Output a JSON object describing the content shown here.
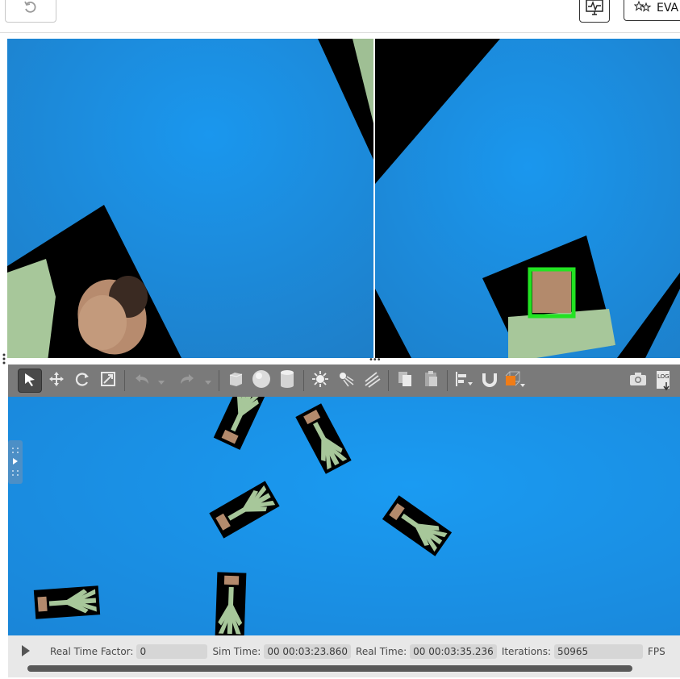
{
  "topbar": {
    "undo_icon": "undo-icon",
    "monitor_icon": "activity-monitor-icon",
    "eval_label": "EVA",
    "eval_icon": "stars-icon"
  },
  "colors": {
    "sky_blue": "#1a93e8",
    "cloth": "#a7c79a",
    "detection_box": "#22e322",
    "toolbar_bg": "#7a7a7a"
  },
  "gazebo": {
    "toolbar_icons": [
      "select-arrow-icon",
      "translate-icon",
      "rotate-icon",
      "scale-icon",
      "undo-icon",
      "redo-icon",
      "box-shape-icon",
      "sphere-shape-icon",
      "cylinder-shape-icon",
      "point-light-icon",
      "spot-light-icon",
      "directional-light-icon",
      "copy-icon",
      "paste-icon",
      "align-icon",
      "snap-icon",
      "view-angle-icon",
      "screenshot-icon",
      "log-icon"
    ],
    "log_label": "LOG",
    "status": {
      "rtf_label": "Real Time Factor:",
      "rtf_value": "0",
      "sim_label": "Sim Time:",
      "sim_value": "00 00:03:23.860",
      "real_label": "Real Time:",
      "real_value": "00 00:03:35.236",
      "iter_label": "Iterations:",
      "iter_value": "50965",
      "fps_label": "FPS"
    }
  }
}
